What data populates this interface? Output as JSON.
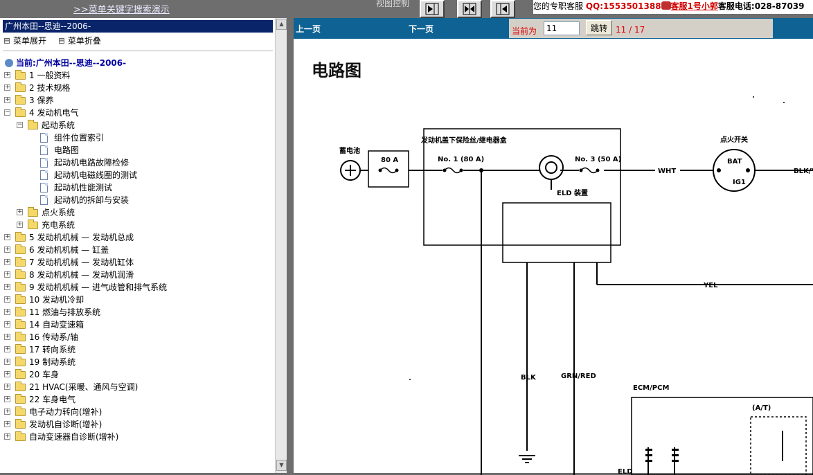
{
  "topbar": {
    "demo_link": ">>菜单关键字搜索演示",
    "view_control": "视图控制",
    "service": {
      "prefix": "您的专职客服",
      "qq": "QQ:1553501388",
      "agent": "客服1号小郭",
      "tel_label": "客服电话:",
      "tel": "028-87039"
    }
  },
  "sidebar": {
    "header": "广州本田--思迪--2006-",
    "expand_label": "菜单展开",
    "collapse_label": "菜单折叠",
    "current": "当前:广州本田--思迪--2006-",
    "tree": [
      {
        "label": "1 一般资料"
      },
      {
        "label": "2 技术规格"
      },
      {
        "label": "3 保养"
      },
      {
        "label": "4 发动机电气"
      },
      {
        "label": "起动系统"
      },
      {
        "label": "组件位置索引"
      },
      {
        "label": "电路图"
      },
      {
        "label": "起动机电路故障检修"
      },
      {
        "label": "起动机电磁线圈的测试"
      },
      {
        "label": "起动机性能测试"
      },
      {
        "label": "起动机的拆卸与安装"
      },
      {
        "label": "点火系统"
      },
      {
        "label": "充电系统"
      },
      {
        "label": "5 发动机机械 — 发动机总成"
      },
      {
        "label": "6 发动机机械 — 缸盖"
      },
      {
        "label": "7 发动机机械 — 发动机缸体"
      },
      {
        "label": "8 发动机机械 — 发动机润滑"
      },
      {
        "label": "9 发动机机械 — 进气歧管和排气系统"
      },
      {
        "label": "10 发动机冷却"
      },
      {
        "label": "11 燃油与排放系统"
      },
      {
        "label": "14 自动变速箱"
      },
      {
        "label": "16 传动系/轴"
      },
      {
        "label": "17 转向系统"
      },
      {
        "label": "19 制动系统"
      },
      {
        "label": "20 车身"
      },
      {
        "label": "21 HVAC(采暖、通风与空调)"
      },
      {
        "label": "22 车身电气"
      },
      {
        "label": "电子动力转向(增补)"
      },
      {
        "label": "发动机自诊断(增补)"
      },
      {
        "label": "自动变速器自诊断(增补)"
      }
    ]
  },
  "pager": {
    "prev": "上一页",
    "next": "下一页",
    "current_label": "当前为",
    "page_value": "11",
    "go_label": "跳转",
    "count": "11 / 17"
  },
  "diagram": {
    "title": "电路图",
    "labels": {
      "battery": "蓄电池",
      "fuse80": "80 A",
      "box": "发动机盖下保险丝/继电器盒",
      "no1": "No. 1 (80 A)",
      "no3": "No. 3 (50 A)",
      "eld": "ELD 装置",
      "wht": "WHT",
      "ign": "点火开关",
      "bat": "BAT",
      "ig1": "IG1",
      "blk_r": "BLK/Y",
      "yel": "YEL",
      "blk": "BLK",
      "grnred": "GRN/RED",
      "ecm": "ECM/PCM",
      "at": "(A/T)",
      "eld2": "ELD"
    }
  }
}
